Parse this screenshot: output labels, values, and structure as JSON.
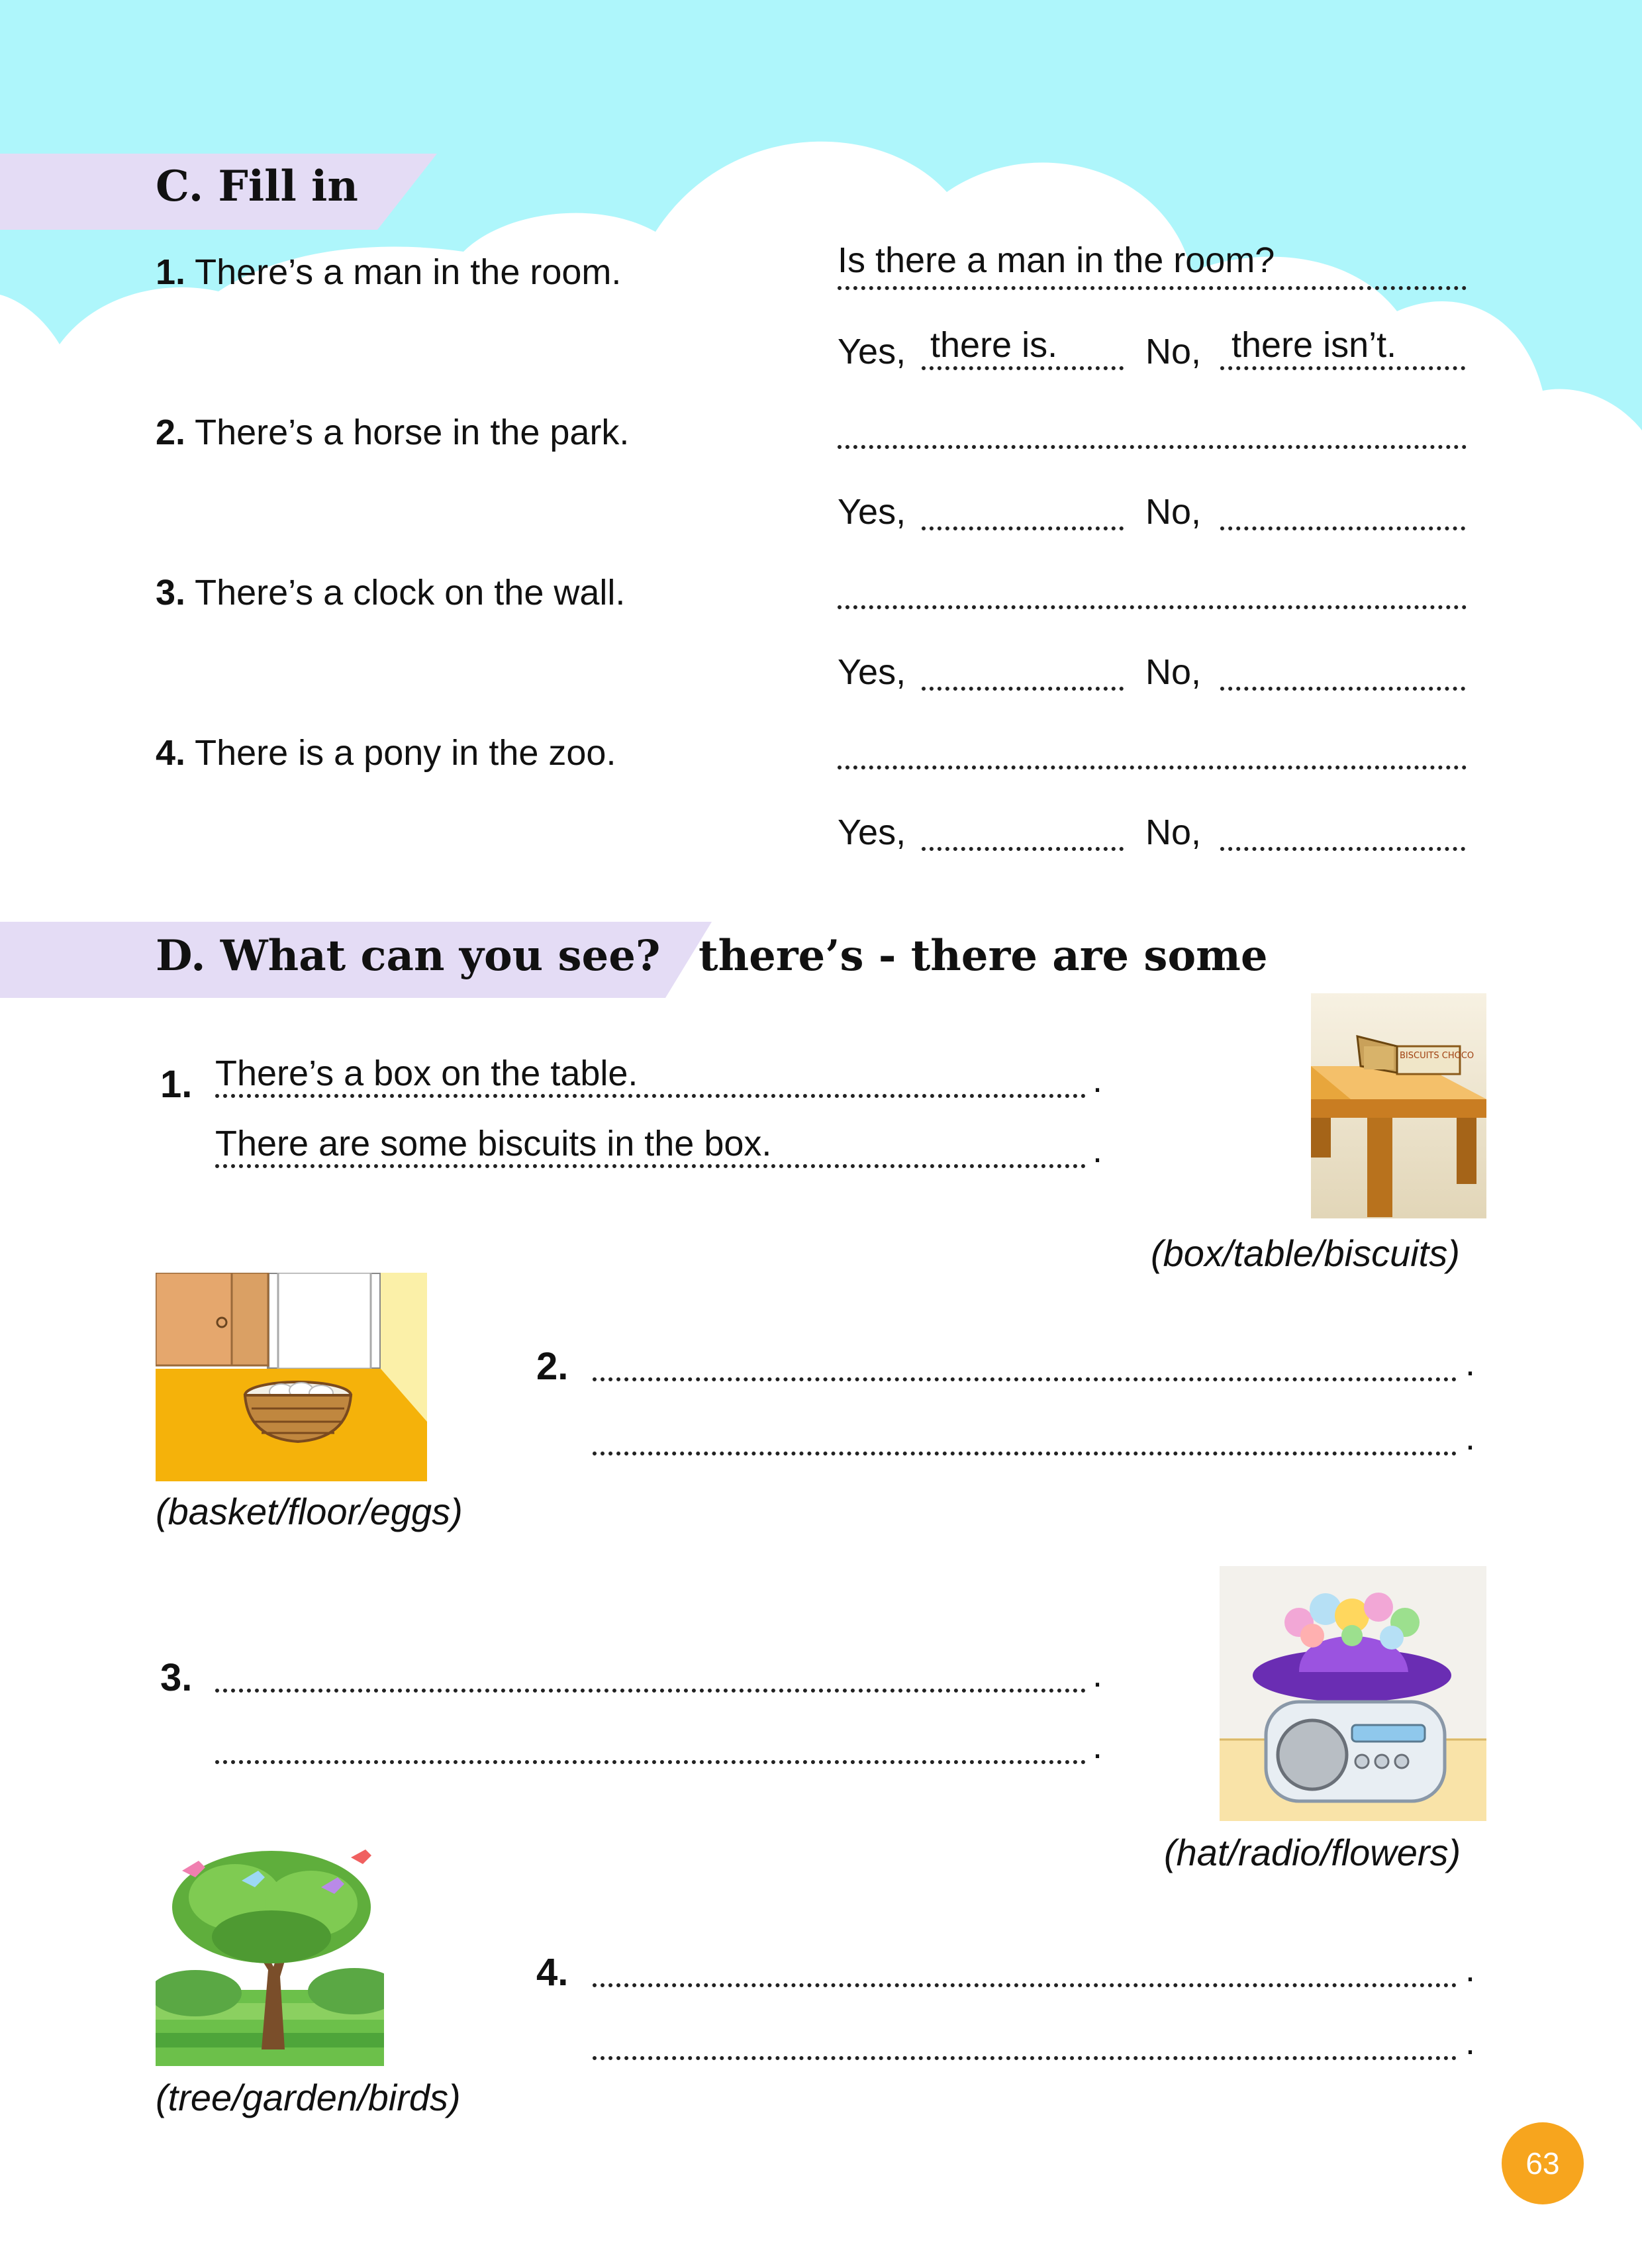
{
  "section_c": {
    "title": "C. Fill in",
    "yes_label": "Yes,",
    "no_label": "No,",
    "items": [
      {
        "number": "1.",
        "statement": "There’s a man in the room.",
        "question": "Is there a man in the room?",
        "yes_answer": "there is.",
        "no_answer": "there isn’t."
      },
      {
        "number": "2.",
        "statement": "There’s a horse in the park.",
        "question": "",
        "yes_answer": "",
        "no_answer": ""
      },
      {
        "number": "3.",
        "statement": "There’s a clock on the wall.",
        "question": "",
        "yes_answer": "",
        "no_answer": ""
      },
      {
        "number": "4.",
        "statement": "There is a pony in the zoo.",
        "question": "",
        "yes_answer": "",
        "no_answer": ""
      }
    ]
  },
  "section_d": {
    "title": "D.  What can you see?",
    "hint": "there’s - there are some",
    "items": [
      {
        "number": "1.",
        "line1": "There’s a box on the table.",
        "line2": "There are some biscuits in the box.",
        "caption": "(box/table/biscuits)"
      },
      {
        "number": "2.",
        "line1": "",
        "line2": "",
        "caption": "(basket/floor/eggs)"
      },
      {
        "number": "3.",
        "line1": "",
        "line2": "",
        "caption": "(hat/radio/flowers)"
      },
      {
        "number": "4.",
        "line1": "",
        "line2": "",
        "caption": "(tree/garden/birds)"
      }
    ],
    "box_label": "BISCUITS CHOCO"
  },
  "page_number": "63",
  "colors": {
    "sky": "#aef6fb",
    "banner": "#e4dcf5",
    "page_badge": "#f7a51e"
  }
}
